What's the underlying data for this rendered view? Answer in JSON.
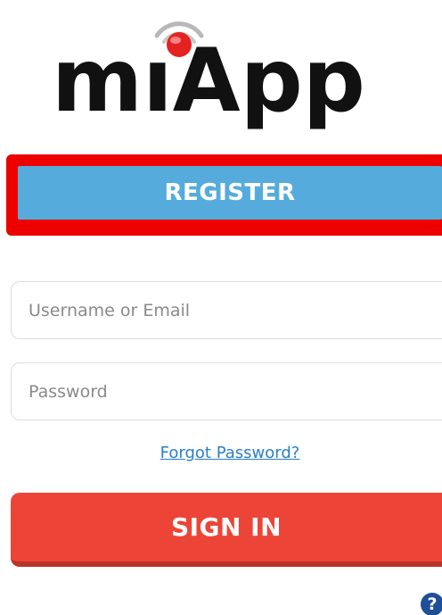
{
  "logo": {
    "brand_name": "miApp",
    "prefix": "m",
    "dotless_i": "ı",
    "suffix": "App",
    "dot_color": "#e52222",
    "wave_color": "#b8b8b8"
  },
  "register": {
    "label": "REGISTER",
    "color": "#55acdc",
    "highlight_color": "#ee0000"
  },
  "login_form": {
    "username_placeholder": "Username or Email",
    "username_value": "",
    "password_placeholder": "Password",
    "password_value": "",
    "forgot_label": "Forgot Password?",
    "signin_label": "SIGN IN",
    "signin_color": "#ec4537"
  },
  "help": {
    "icon": "question-circle-icon",
    "glyph": "?",
    "color": "#1f4f96"
  }
}
